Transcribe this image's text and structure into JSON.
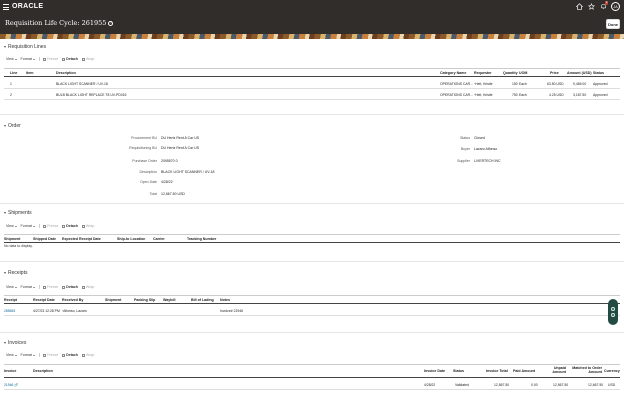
{
  "header": {
    "logo": "ORACLE",
    "avatar_initials": "JA",
    "notification_count": "2"
  },
  "title": {
    "text": "Requisition Life Cycle: 261955",
    "done": "Done"
  },
  "toolbar": {
    "view": "View",
    "format": "Format",
    "freeze": "Freeze",
    "detach": "Detach",
    "wrap": "Wrap"
  },
  "requisition_lines": {
    "title": "Requisition Lines",
    "columns": [
      "Line",
      "Item",
      "Description",
      "Category Name",
      "Requester",
      "Quantity",
      "UOM",
      "Price",
      "Amount (USD)",
      "Status"
    ],
    "rows": [
      [
        "1",
        "",
        "BLACK LIGHT SCANNER / UV-18",
        "OPERATIONS CAR...",
        "Heit, Kristie",
        "150",
        "Each",
        "63.50 USD",
        "9,465.00",
        "Approved"
      ],
      [
        "2",
        "",
        "BULB BLACK LIGHT REPLACE T8 UV-PD015",
        "OPERATIONS CAR...",
        "Heit, Kristie",
        "750",
        "Each",
        "4.25 USD",
        "3,187.50",
        "Approved"
      ]
    ]
  },
  "order": {
    "title": "Order",
    "left": [
      {
        "label": "Procurement BU",
        "value": "DU Hertz Rent A Car US"
      },
      {
        "label": "Requisitioning BU",
        "value": "DU Hertz Rent A Car US"
      },
      {
        "label": "Purchase Order",
        "value": "2095570 0"
      },
      {
        "label": "Description",
        "value": "BLACK LIGHT SCANNER / UV-18"
      },
      {
        "label": "Open Date",
        "value": "4/28/22"
      },
      {
        "label": "Total",
        "value": "12,667.50 USD"
      }
    ],
    "right": [
      {
        "label": "Status",
        "value": "Closed"
      },
      {
        "label": "Buyer",
        "value": "Lazaro Alfonso"
      },
      {
        "label": "Supplier",
        "value": "LIVERTECH INC"
      }
    ]
  },
  "shipments": {
    "title": "Shipments",
    "columns": [
      "Shipment",
      "Shipped Date",
      "Expected Receipt Date",
      "Ship-to Location",
      "Carrier",
      "Tracking Number"
    ],
    "empty": "No data to display."
  },
  "receipts": {
    "title": "Receipts",
    "columns": [
      "Receipt",
      "Receipt Date",
      "Received By",
      "Shipment",
      "Packing Slip",
      "Waybill",
      "Bill of Lading",
      "Notes"
    ],
    "rows": [
      [
        "285653",
        "4/27/23 12:28 PM",
        "Alfonso, Lazaro",
        "",
        "",
        "",
        "",
        "Invoice# 21946"
      ]
    ]
  },
  "invoices": {
    "title": "Invoices",
    "columns": [
      "Invoice",
      "Description",
      "Invoice Date",
      "Status",
      "Invoice Total",
      "Paid Amount",
      "Unpaid Amount",
      "Matched to Order Amount",
      "Currency"
    ],
    "rows": [
      [
        "21946",
        "",
        "4/28/22",
        "Validated",
        "12,567.50",
        "0.00",
        "12,567.50",
        "12,667.50",
        "USD"
      ]
    ]
  }
}
